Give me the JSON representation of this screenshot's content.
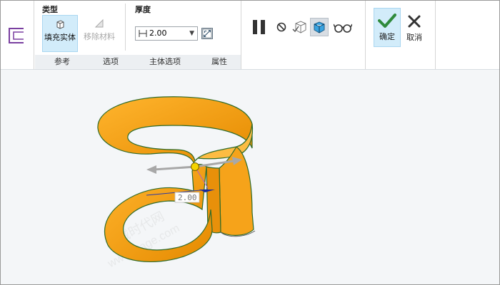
{
  "ribbon": {
    "type_group": {
      "label": "类型",
      "fill_solid": "填充实体",
      "remove_material": "移除材料"
    },
    "thickness_group": {
      "label": "厚度",
      "value": "2.00"
    },
    "tabs": [
      "参考",
      "选项",
      "主体选项",
      "属性"
    ],
    "ok_label": "确定",
    "cancel_label": "取消"
  },
  "viewport": {
    "dimension_value": "2.00",
    "watermark_line1": "机械时代网",
    "watermark_line2": "www.jxage.com"
  },
  "colors": {
    "accent": "#cfe9fb",
    "model_fill": "#f29a0a",
    "model_edge": "#2f6b2a",
    "drag_arrow": "#a8a8a8",
    "ok_check": "#2f8a3c"
  },
  "icons": [
    "thicken-feature-icon",
    "pause-icon",
    "no-preview-icon",
    "check-geometry-icon",
    "shaded-preview-icon",
    "glasses-icon",
    "checkmark-icon",
    "x-icon"
  ]
}
